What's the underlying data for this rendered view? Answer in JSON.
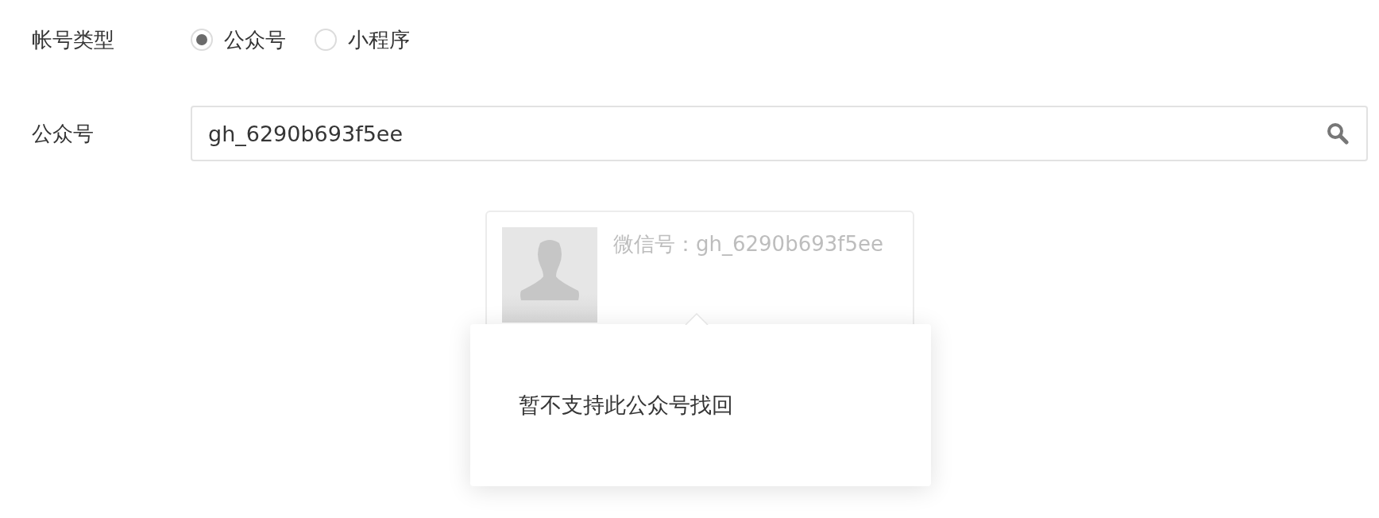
{
  "fields": [
    {
      "label": "帐号类型",
      "kind": "radio",
      "options": [
        {
          "label": "公众号",
          "selected": true
        },
        {
          "label": "小程序",
          "selected": false
        }
      ]
    },
    {
      "label": "公众号",
      "kind": "search",
      "value": "gh_6290b693f5ee"
    }
  ],
  "result_card": {
    "wechat_id": "微信号：gh_6290b693f5ee"
  },
  "popover": {
    "message": "暂不支持此公众号找回"
  }
}
